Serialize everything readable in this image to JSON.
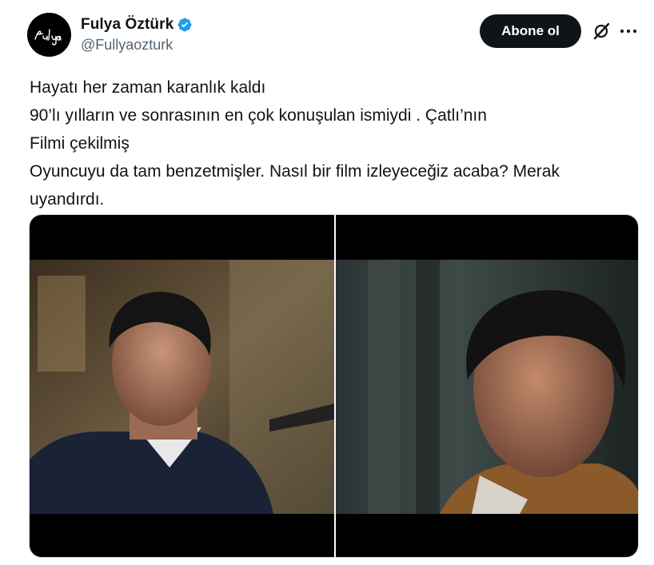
{
  "author": {
    "display_name": "Fulya Öztürk",
    "handle": "@Fullyaozturk",
    "avatar_text": "Fulya",
    "verified": true,
    "verified_color": "#1d9bf0"
  },
  "actions": {
    "follow_label": "Abone ol",
    "grok_icon": "grok-icon",
    "more_icon": "more-icon"
  },
  "tweet": {
    "lines": [
      "Hayatı her zaman karanlık kaldı",
      "90’lı yılların ve sonrasının en çok konuşulan ismiydi . Çatlı’nın",
      "Filmi çekilmiş",
      "Oyuncuyu da tam benzetmişler. Nasıl bir film izleyeceğiz acaba? Merak",
      "uyandırdı."
    ]
  },
  "media": {
    "count": 2,
    "items": [
      "left-photo",
      "right-photo"
    ]
  },
  "colors": {
    "text_primary": "#0f1419",
    "text_secondary": "#536471",
    "button_bg": "#0f1419",
    "border": "#cfd9de"
  }
}
